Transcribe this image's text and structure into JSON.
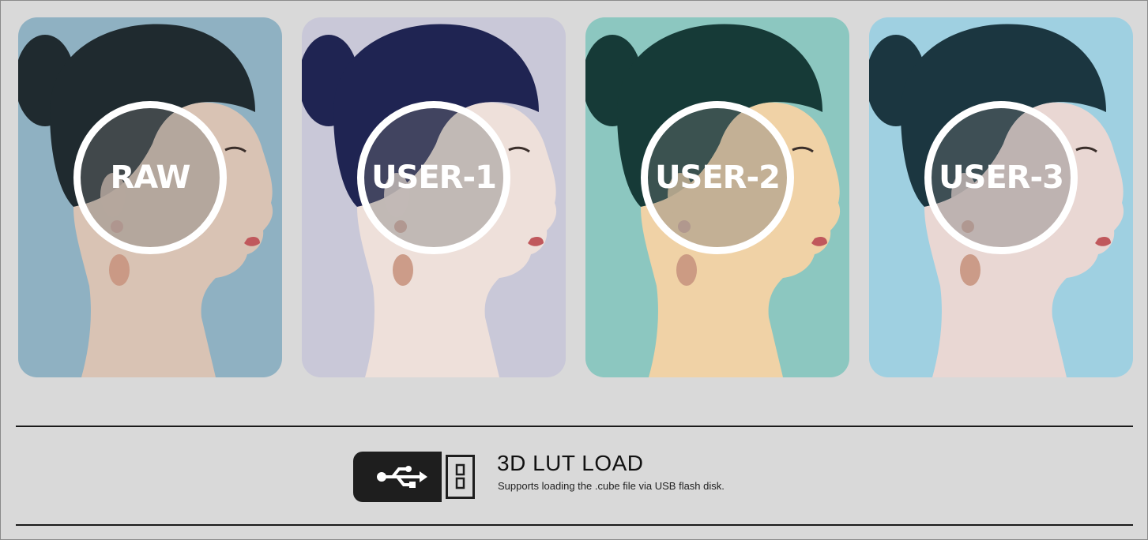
{
  "tiles": [
    {
      "label": "RAW",
      "bg": "#8fb1c2",
      "hair": "#1f2a2f",
      "skin": "#d9c3b4"
    },
    {
      "label": "USER-1",
      "bg": "#c9c8d8",
      "hair": "#1f2452",
      "skin": "#eee0da"
    },
    {
      "label": "USER-2",
      "bg": "#8cc7c0",
      "hair": "#163a37",
      "skin": "#f0d2a6"
    },
    {
      "label": "USER-3",
      "bg": "#9fd0e1",
      "hair": "#1b3640",
      "skin": "#e9d7d3"
    }
  ],
  "feature": {
    "title": "3D LUT LOAD",
    "subtitle": "Supports loading the .cube file via USB flash disk.",
    "icon": "usb-flash-drive-icon"
  }
}
